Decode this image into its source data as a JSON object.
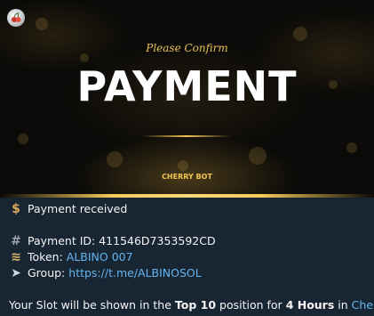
{
  "banner": {
    "subtitle": "Please Confirm",
    "title": "PAYMENT",
    "brand": "CHERRY BOT",
    "avatar_icon": "cherry-logo-icon"
  },
  "message": {
    "payment_received": "Payment received",
    "payment_id_label": "Payment ID:",
    "payment_id_value": "411546D7353592CD",
    "token_label": "Token:",
    "token_value": "ALBINO 007",
    "group_label": "Group:",
    "group_value": "https://t.me/ALBINOSOL",
    "slot_prefix": "Your Slot will be shown in the",
    "slot_top": "Top 10",
    "slot_mid": "position for",
    "slot_hours": "4 Hours",
    "slot_in": "in",
    "slot_link": "Cherry"
  },
  "colors": {
    "background": "#182533",
    "link": "#64b5ef",
    "gold": "#f1c453",
    "text": "#f5f5f5"
  }
}
